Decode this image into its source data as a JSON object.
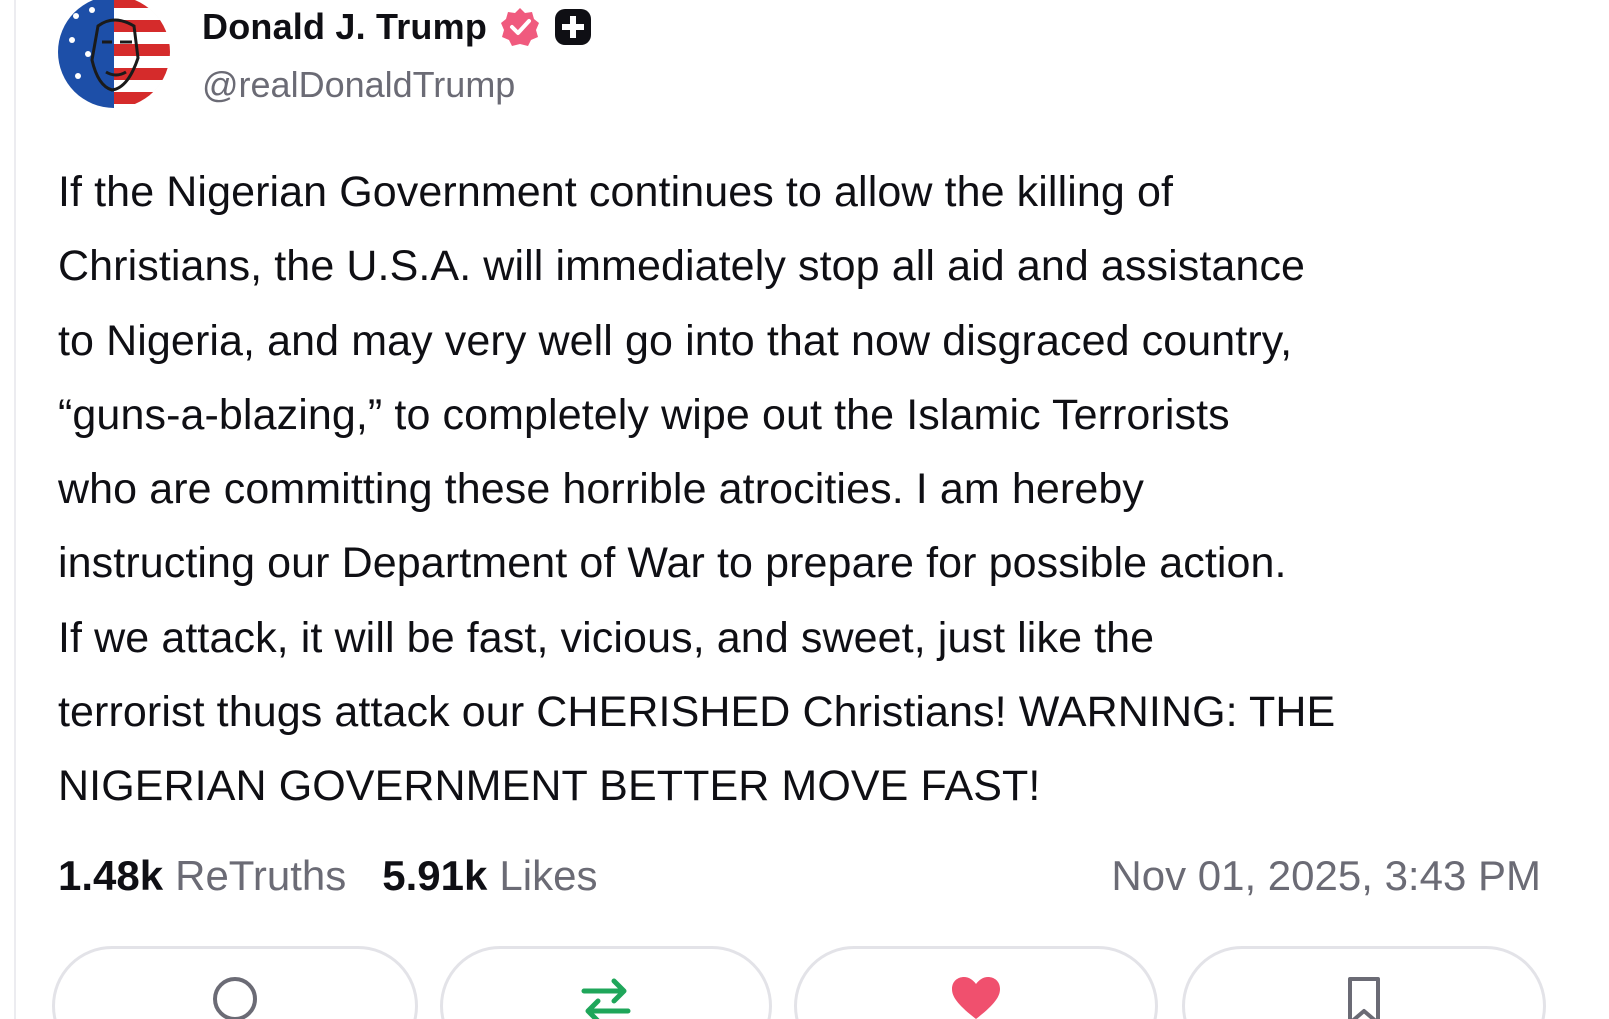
{
  "post": {
    "author": {
      "display_name": "Donald J. Trump",
      "handle": "@realDonaldTrump",
      "avatar_icon": "avatar-flag-face",
      "verified_icon": "verified-badge-icon",
      "plus_icon": "plus-badge-icon"
    },
    "body_lines": [
      "If the Nigerian Government continues to allow the killing of",
      "Christians, the U.S.A. will immediately stop all aid and assistance",
      "to Nigeria, and may very well go into that now disgraced country,",
      "“guns-a-blazing,” to completely wipe out the Islamic Terrorists",
      "who are committing these horrible atrocities. I am hereby",
      "instructing our Department of War to prepare for possible action.",
      "If we attack, it will be fast, vicious, and sweet, just like the",
      "terrorist thugs attack our CHERISHED Christians! WARNING: THE",
      "NIGERIAN GOVERNMENT BETTER MOVE FAST!"
    ],
    "stats": {
      "retruths_count": "1.48k",
      "retruths_label": "ReTruths",
      "likes_count": "5.91k",
      "likes_label": "Likes"
    },
    "timestamp": "Nov 01, 2025, 3:43 PM"
  },
  "actions": [
    {
      "name": "reply",
      "icon": "reply-icon"
    },
    {
      "name": "retruth",
      "icon": "retruth-icon"
    },
    {
      "name": "like",
      "icon": "heart-icon"
    },
    {
      "name": "bookmark",
      "icon": "bookmark-icon"
    }
  ],
  "colors": {
    "text": "#0f0f14",
    "muted": "#6b6b75",
    "verified": "#f05a7e",
    "retruth_green": "#1fa65a",
    "like_pink": "#f0506e",
    "border": "#e3e3e8"
  }
}
